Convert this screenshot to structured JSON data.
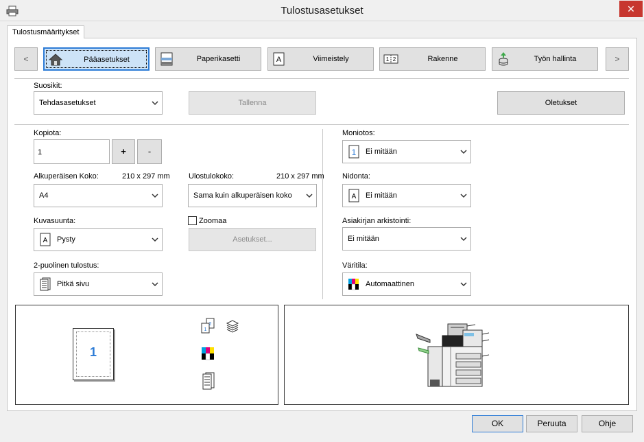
{
  "window": {
    "title": "Tulostusasetukset",
    "close_glyph": "✕"
  },
  "tab": {
    "label": "Tulostusmääritykset"
  },
  "nav": {
    "prev_glyph": "<",
    "next_glyph": ">",
    "tabs": [
      {
        "label": "Pääasetukset",
        "icon": "home-icon",
        "active": true
      },
      {
        "label": "Paperikasetti",
        "icon": "paper-tray-icon",
        "active": false
      },
      {
        "label": "Viimeistely",
        "icon": "finishing-icon",
        "active": false
      },
      {
        "label": "Rakenne",
        "icon": "layout-icon",
        "active": false
      },
      {
        "label": "Työn hallinta",
        "icon": "job-handling-icon",
        "active": false
      }
    ]
  },
  "favorites": {
    "label": "Suosikit:",
    "value": "Tehdasasetukset",
    "save_label": "Tallenna",
    "defaults_label": "Oletukset"
  },
  "copies": {
    "label": "Kopiota:",
    "value": "1",
    "plus": "+",
    "minus": "-"
  },
  "original_size": {
    "label": "Alkuperäisen Koko:",
    "dims": "210 x 297 mm",
    "value": "A4"
  },
  "output_size": {
    "label": "Ulostulokoko:",
    "dims": "210 x 297 mm",
    "value": "Sama kuin alkuperäisen koko"
  },
  "orientation": {
    "label": "Kuvasuunta:",
    "value": "Pysty",
    "icon_letter": "A"
  },
  "zoom": {
    "label": "Zoomaa",
    "settings_label": "Asetukset..."
  },
  "duplex": {
    "label": "2-puolinen tulostus:",
    "value": "Pitkä sivu"
  },
  "nup": {
    "label": "Moniotos:",
    "value": "Ei mitään",
    "icon_digit": "1"
  },
  "stapling": {
    "label": "Nidonta:",
    "value": "Ei mitään",
    "icon_letter": "A"
  },
  "archive": {
    "label": "Asiakirjan arkistointi:",
    "value": "Ei mitään"
  },
  "color_mode": {
    "label": "Väritila:",
    "value": "Automaattinen"
  },
  "preview": {
    "page_number": "1"
  },
  "colors": {
    "accent": "#2c7bd6",
    "cyan": "#00a0e0",
    "magenta": "#e0007a",
    "yellow": "#ffe000",
    "black": "#000000"
  },
  "footer": {
    "ok": "OK",
    "cancel": "Peruuta",
    "help": "Ohje"
  }
}
